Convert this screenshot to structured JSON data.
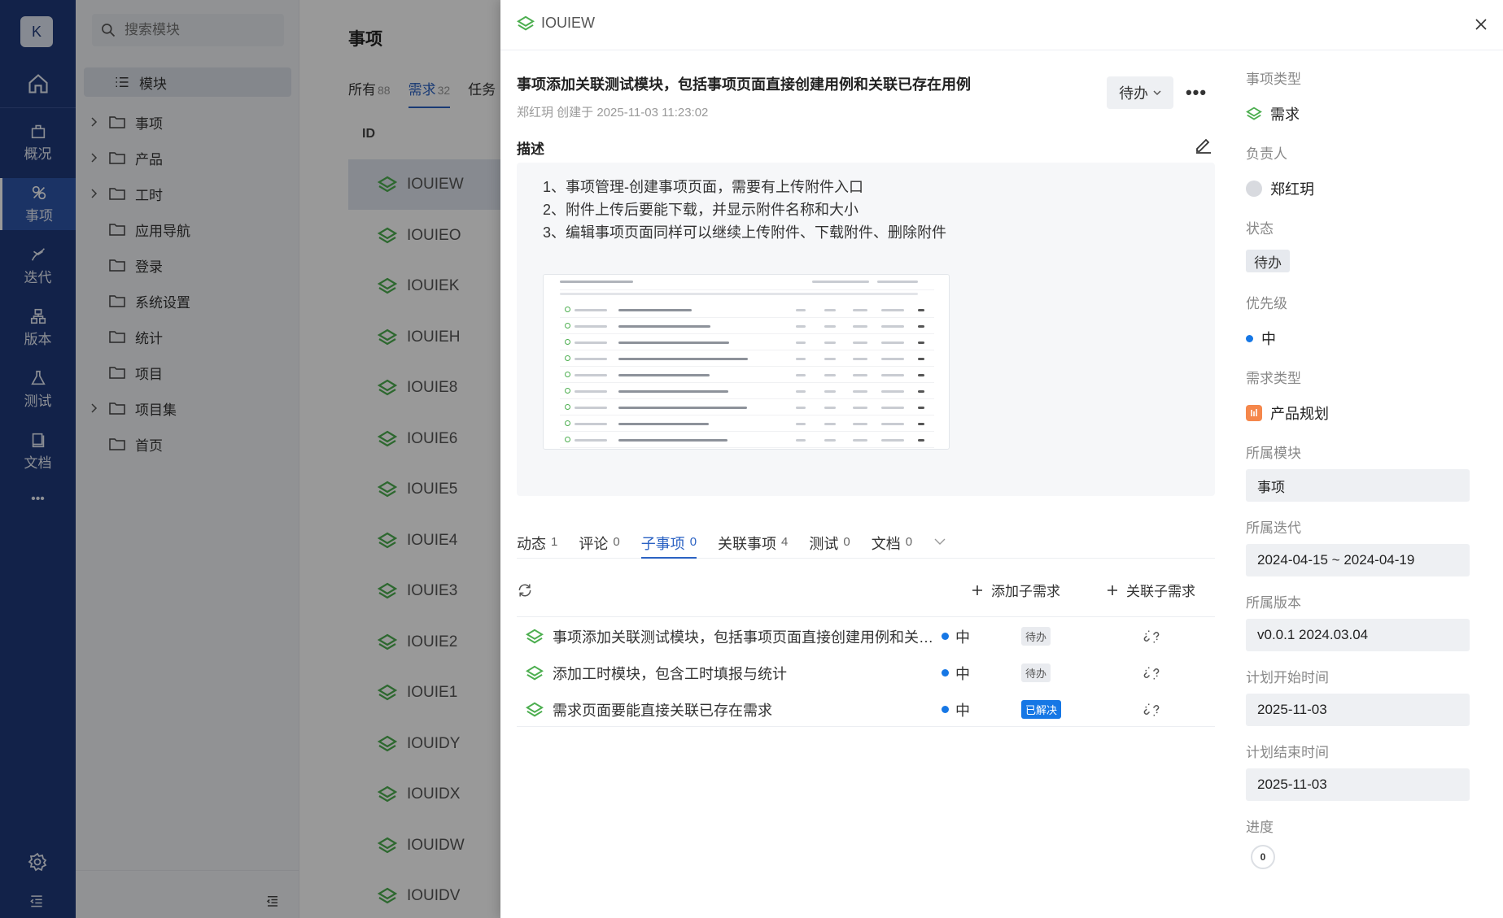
{
  "nav": {
    "user_initial": "K",
    "items": [
      {
        "label": "概况",
        "icon": "overview-icon"
      },
      {
        "label": "事项",
        "icon": "issues-icon"
      },
      {
        "label": "迭代",
        "icon": "sprint-icon"
      },
      {
        "label": "版本",
        "icon": "version-icon"
      },
      {
        "label": "测试",
        "icon": "test-icon"
      },
      {
        "label": "文档",
        "icon": "docs-icon"
      }
    ],
    "more": "•••"
  },
  "tree": {
    "search_placeholder": "搜索模块",
    "root": "模块",
    "items": [
      {
        "label": "事项",
        "expandable": true
      },
      {
        "label": "产品",
        "expandable": true
      },
      {
        "label": "工时",
        "expandable": true
      },
      {
        "label": "应用导航",
        "expandable": false
      },
      {
        "label": "登录",
        "expandable": false
      },
      {
        "label": "系统设置",
        "expandable": false
      },
      {
        "label": "统计",
        "expandable": false
      },
      {
        "label": "项目",
        "expandable": false
      },
      {
        "label": "项目集",
        "expandable": true
      },
      {
        "label": "首页",
        "expandable": false
      }
    ]
  },
  "main": {
    "title": "事项",
    "tabs": [
      {
        "label": "所有",
        "count": "88"
      },
      {
        "label": "需求",
        "count": "32"
      },
      {
        "label": "任务",
        "count": ""
      }
    ],
    "col_id": "ID",
    "rows": [
      "IOUIEW",
      "IOUIEO",
      "IOUIEK",
      "IOUIEH",
      "IOUIE8",
      "IOUIE6",
      "IOUIE5",
      "IOUIE4",
      "IOUIE3",
      "IOUIE2",
      "IOUIE1",
      "IOUIDY",
      "IOUIDX",
      "IOUIDW",
      "IOUIDV"
    ]
  },
  "drawer": {
    "key": "IOUIEW",
    "title": "事项添加关联测试模块，包括事项页面直接创建用例和关联已存在用例",
    "meta": "郑红玥 创建于 2025-11-03 11:23:02",
    "status": "待办",
    "more": "•••",
    "desc_label": "描述",
    "desc_lines": [
      "1、事项管理-创建事项页面，需要有上传附件入口",
      "2、附件上传后要能下载，并显示附件名称和大小",
      "3、编辑事项页面同样可以继续上传附件、下载附件、删除附件"
    ],
    "tabs": [
      {
        "label": "动态",
        "count": "1"
      },
      {
        "label": "评论",
        "count": "0"
      },
      {
        "label": "子事项",
        "count": "0"
      },
      {
        "label": "关联事项",
        "count": "4"
      },
      {
        "label": "测试",
        "count": "0"
      },
      {
        "label": "文档",
        "count": "0"
      }
    ],
    "add_child": "添加子需求",
    "link_child": "关联子需求",
    "children": [
      {
        "title": "事项添加关联测试模块，包括事项页面直接创建用例和关联已存在用例",
        "priority": "中",
        "status": "待办"
      },
      {
        "title": "添加工时模块，包含工时填报与统计",
        "priority": "中",
        "status": "待办"
      },
      {
        "title": "需求页面要能直接关联已存在需求",
        "priority": "中",
        "status": "已解决"
      }
    ]
  },
  "props": {
    "type_label": "事项类型",
    "type_value": "需求",
    "assignee_label": "负责人",
    "assignee_value": "郑红玥",
    "status_label": "状态",
    "status_value": "待办",
    "priority_label": "优先级",
    "priority_value": "中",
    "reqtype_label": "需求类型",
    "reqtype_value": "产品规划",
    "module_label": "所属模块",
    "module_value": "事项",
    "sprint_label": "所属迭代",
    "sprint_value": "2024-04-15 ~ 2024-04-19",
    "version_label": "所属版本",
    "version_value": "v0.0.1 2024.03.04",
    "start_label": "计划开始时间",
    "start_value": "2025-11-03",
    "end_label": "计划结束时间",
    "end_value": "2025-11-03",
    "progress_label": "进度",
    "progress_value": "0"
  },
  "colors": {
    "brand": "#1e3a7a",
    "accent": "#2b62c3",
    "green": "#4cae4f",
    "priority": "#1677e5"
  }
}
